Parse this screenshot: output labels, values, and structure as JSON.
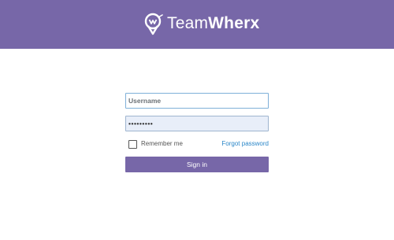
{
  "header": {
    "brand_light": "Team",
    "brand_bold": "Wherx",
    "logo_icon": "location-pin-logo-icon",
    "background_color": "#7767a8"
  },
  "login": {
    "username_placeholder": "Username",
    "username_value": "",
    "password_value": "•••••••••",
    "remember_label": "Remember me",
    "remember_checked": false,
    "forgot_label": "Forgot password",
    "signin_label": "Sign in",
    "accent_color": "#7767a8",
    "link_color": "#2a86c8"
  }
}
